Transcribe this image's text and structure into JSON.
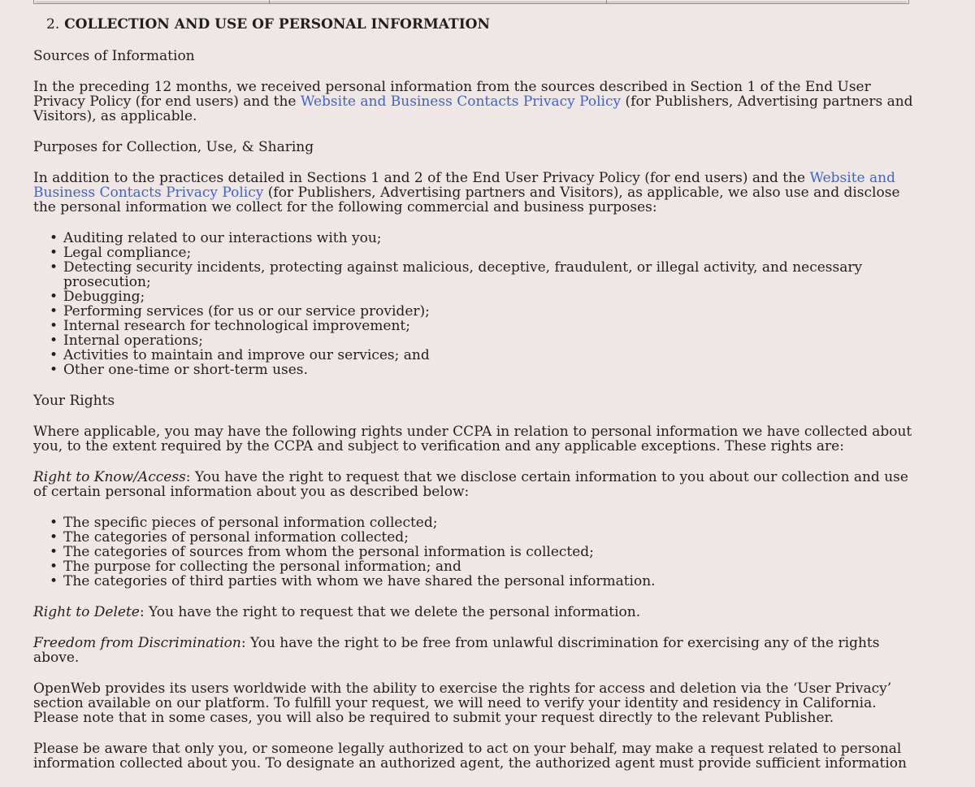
{
  "section": {
    "number": "2.",
    "title": "COLLECTION AND USE OF PERSONAL INFORMATION"
  },
  "sources": {
    "heading": "Sources of Information",
    "text_before_link": "In the preceding 12 months, we received personal information from the sources described in Section 1 of the End User Privacy Policy (for end users) and the ",
    "link": "Website and Business Contacts Privacy Policy",
    "text_after_link": " (for Publishers, Advertising partners and Visitors), as applicable."
  },
  "purposes": {
    "heading": "Purposes for Collection, Use, & Sharing",
    "text_before_link": "In addition to the practices detailed in Sections 1 and 2 of the End User Privacy Policy (for end users) and the ",
    "link": "Website and Business Contacts Privacy Policy",
    "text_after_link": " (for Publishers, Advertising partners and Visitors), as applicable, we also use and disclose the personal information we collect for the following commercial and business purposes:",
    "items": [
      "Auditing related to our interactions with you;",
      "Legal compliance;",
      "Detecting security incidents, protecting against malicious, deceptive, fraudulent, or illegal activity, and necessary prosecution;",
      "Debugging;",
      "Performing services (for us or our service provider);",
      "Internal research for technological improvement;",
      "Internal operations;",
      "Activities to maintain and improve our services; and",
      "Other one-time or short-term uses."
    ]
  },
  "rights": {
    "heading": "Your Rights",
    "intro": "Where applicable, you may have the following rights under CCPA in relation to personal information we have collected about you, to the extent required by the CCPA and subject to verification and any applicable exceptions. These rights are:",
    "know_label": "Right to Know/Access",
    "know_text": ": You have the right to request that we disclose certain information to you about our collection and use of certain personal information about you as described below:",
    "know_items": [
      "The specific pieces of personal information collected;",
      "The categories of personal information collected;",
      "The categories of sources from whom the personal information is collected;",
      "The purpose for collecting the personal information; and",
      "The categories of third parties with whom we have shared the personal information."
    ],
    "delete_label": "Right to Delete",
    "delete_text": ": You have the right to request that we delete the personal information.",
    "freedom_label": "Freedom from Discrimination",
    "freedom_text": ": You have the right to be free from unlawful discrimination for exercising any of the rights above.",
    "openweb": "OpenWeb provides its users worldwide with the ability to exercise the rights for access and deletion via the ‘User Privacy’ section available on our platform. To fulfill your request, we will need to verify your identity and residency in California. Please note that in some cases, you will also be required to submit your request directly to the relevant Publisher.",
    "agent": "Please be aware that only you, or someone legally authorized to act on your behalf, may make a request related to personal information collected about you. To designate an authorized agent, the authorized agent must provide sufficient information"
  }
}
